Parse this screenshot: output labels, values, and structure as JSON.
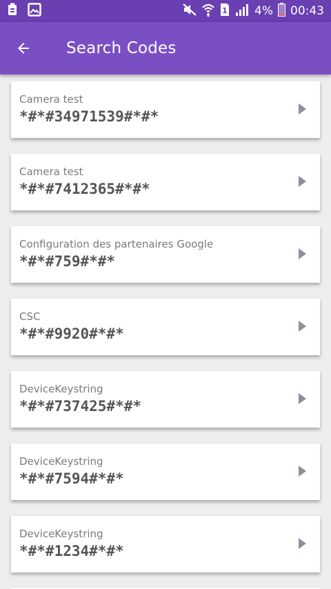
{
  "status": {
    "battery_percent": "4%",
    "time": "00:43",
    "icons": [
      "notification-icon",
      "image-icon",
      "mute-icon",
      "wifi-icon",
      "sim-icon",
      "signal-icon",
      "battery-icon"
    ]
  },
  "appbar": {
    "back_icon": "arrow-left-icon",
    "title": "Search Codes"
  },
  "colors": {
    "status_bar": "#6a3fb2",
    "app_bar": "#7b4fc4",
    "background": "#eeeeee",
    "card": "#ffffff"
  },
  "codes": [
    {
      "label": "Camera test",
      "code": "*#*#34971539#*#*"
    },
    {
      "label": "Camera test",
      "code": "*#*#7412365#*#*"
    },
    {
      "label": "Configuration des partenaires Google",
      "code": "*#*#759#*#*"
    },
    {
      "label": "CSC",
      "code": "*#*#9920#*#*"
    },
    {
      "label": "DeviceKeystring",
      "code": "*#*#737425#*#*"
    },
    {
      "label": "DeviceKeystring",
      "code": "*#*#7594#*#*"
    },
    {
      "label": "DeviceKeystring",
      "code": "*#*#1234#*#*"
    }
  ]
}
